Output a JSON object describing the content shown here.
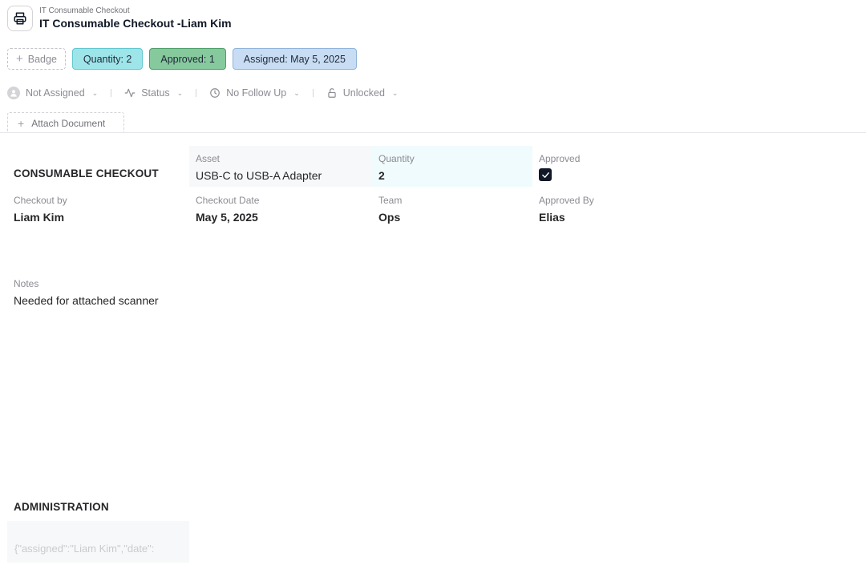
{
  "header": {
    "subtitle": "IT Consumable Checkout",
    "title": "IT Consumable Checkout -Liam Kim",
    "icon": "printer-icon"
  },
  "badges": {
    "add_label": "Badge",
    "quantity": "Quantity: 2",
    "approved": "Approved: 1",
    "assigned": "Assigned: May 5, 2025",
    "colors": {
      "quantity": "#9ee5ea",
      "approved": "#86c99d",
      "assigned": "#c8ddf3"
    }
  },
  "toolbar": {
    "assignee": "Not Assigned",
    "status": "Status",
    "follow_up": "No Follow Up",
    "lock": "Unlocked"
  },
  "attach_label": "Attach Document",
  "consumable": {
    "section_title": "CONSUMABLE CHECKOUT",
    "asset_label": "Asset",
    "asset": "USB-C to USB-A Adapter",
    "quantity_label": "Quantity",
    "quantity": "2",
    "approved_label": "Approved",
    "approved": true,
    "checkout_by_label": "Checkout by",
    "checkout_by": "Liam Kim",
    "checkout_date_label": "Checkout Date",
    "checkout_date": "May 5, 2025",
    "team_label": "Team",
    "team": "Ops",
    "approved_by_label": "Approved By",
    "approved_by": "Elias",
    "notes_label": "Notes",
    "notes": "Needed for attached scanner"
  },
  "administration": {
    "section_title": "ADMINISTRATION",
    "raw": "{\"assigned\":\"Liam Kim\",\"date\":"
  }
}
